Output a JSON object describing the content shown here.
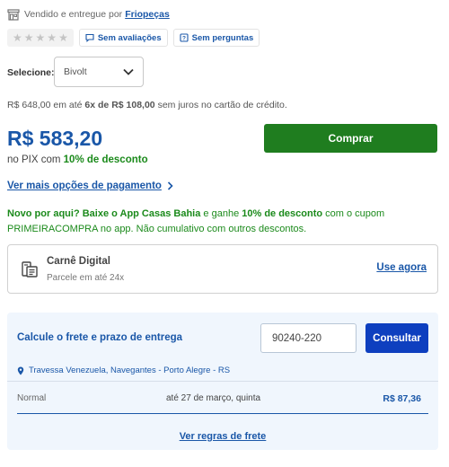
{
  "seller": {
    "prefix": "Vendido e entregue por",
    "name": "Friopeças"
  },
  "rating": {
    "stars": 0,
    "max_stars": 5,
    "reviews_label": "Sem avaliações",
    "questions_label": "Sem perguntas"
  },
  "variant": {
    "label": "Selecione:",
    "selected": "Bivolt"
  },
  "installments": {
    "full_price": "R$ 648,00",
    "text_mid": "em até",
    "plan": "6x de R$ 108,00",
    "text_end": "sem juros no cartão de crédito."
  },
  "pix": {
    "price": "R$ 583,20",
    "prefix": "no PIX com",
    "discount": "10% de desconto"
  },
  "buy_button": "Comprar",
  "more_payment": "Ver mais opções de pagamento",
  "promo": {
    "part1": "Novo por aqui? Baixe o App Casas Bahia",
    "part2": "e ganhe",
    "part3": "10% de desconto",
    "part4": "com o cupom PRIMEIRACOMPRA no app. Não cumulativo com outros descontos."
  },
  "carne": {
    "title": "Carnê Digital",
    "subtitle": "Parcele em até 24x",
    "link": "Use agora"
  },
  "freight": {
    "title": "Calcule o frete e prazo de entrega",
    "cep_value": "90240-220",
    "consult_button": "Consultar",
    "address": "Travessa Venezuela, Navegantes - Porto Alegre - RS",
    "options": [
      {
        "type": "Normal",
        "date": "até 27 de março, quinta",
        "price": "R$ 87,36"
      }
    ],
    "rules_link": "Ver regras de frete"
  },
  "colors": {
    "brand_blue": "#1a57a8",
    "buy_green": "#1f7d1f",
    "promo_green": "#1b8a1b",
    "consult_blue": "#0e3fbf"
  }
}
